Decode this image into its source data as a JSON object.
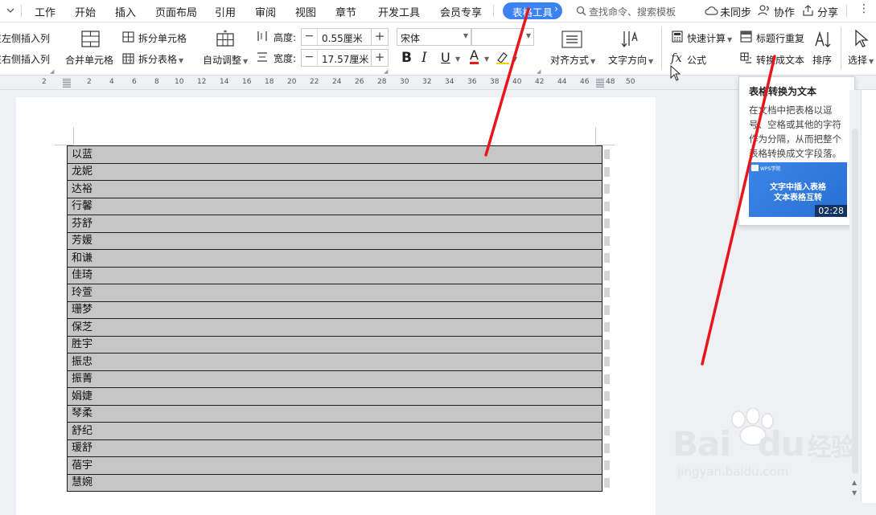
{
  "menubar": {
    "items": [
      "工作",
      "开始",
      "插入",
      "页面布局",
      "引用",
      "审阅",
      "视图",
      "章节",
      "开发工具",
      "会员专享"
    ],
    "active_tab": "表格工具",
    "search_placeholder": "查找命令、搜索模板",
    "sync": "未同步",
    "collab": "协作",
    "share": "分享"
  },
  "ribbon": {
    "insert_left": "在左侧插入列",
    "insert_right": "在右侧插入列",
    "merge_cells": "合并单元格",
    "split_cells": "拆分单元格",
    "split_table": "拆分表格",
    "auto_adjust": "自动调整",
    "height_label": "高度:",
    "height_value": "0.55厘米",
    "width_label": "宽度:",
    "width_value": "17.57厘米",
    "font_name": "宋体",
    "font_size": "",
    "bold": "B",
    "italic": "I",
    "underline": "U",
    "font_color": "A",
    "align": "对齐方式",
    "text_direction": "文字方向",
    "quick_calc": "快速计算",
    "formula": "公式",
    "repeat_header": "标题行重复",
    "convert_to_text": "转换成文本",
    "sort": "排序",
    "select": "选择"
  },
  "ruler": {
    "ticks": [
      "2",
      "2",
      "4",
      "6",
      "8",
      "10",
      "12",
      "14",
      "16",
      "18",
      "20",
      "22",
      "24",
      "26",
      "28",
      "30",
      "32",
      "34",
      "36",
      "38",
      "40",
      "42",
      "44",
      "46",
      "48",
      "50"
    ]
  },
  "table": {
    "rows": [
      "以蓝",
      "龙妮",
      "达裕",
      "行馨",
      "芬舒",
      "芳媛",
      "和谦",
      "佳琦",
      "玲萱",
      "珊梦",
      "保芝",
      "胜宇",
      "振忠",
      "振菁",
      "娟婕",
      "琴柔",
      "舒纪",
      "瑗舒",
      "蓓宇",
      "慧婉"
    ]
  },
  "tooltip": {
    "title": "表格转换为文本",
    "body": "在文档中把表格以逗号、空格或其他的字符作为分隔，从而把整个表格转换成文字段落。",
    "thumb_logo": "WPS学院",
    "thumb_line1": "文字中插入表格",
    "thumb_line2": "文本表格互转",
    "duration": "02:28"
  },
  "watermark": {
    "brand_a": "Bai",
    "brand_b": "du",
    "brand_cn": "经验",
    "url": "jingyan.baidu.com"
  },
  "colors": {
    "accent": "#3d82f2",
    "annotation": "#e8161b",
    "cell_fill": "#c6c6c6"
  }
}
